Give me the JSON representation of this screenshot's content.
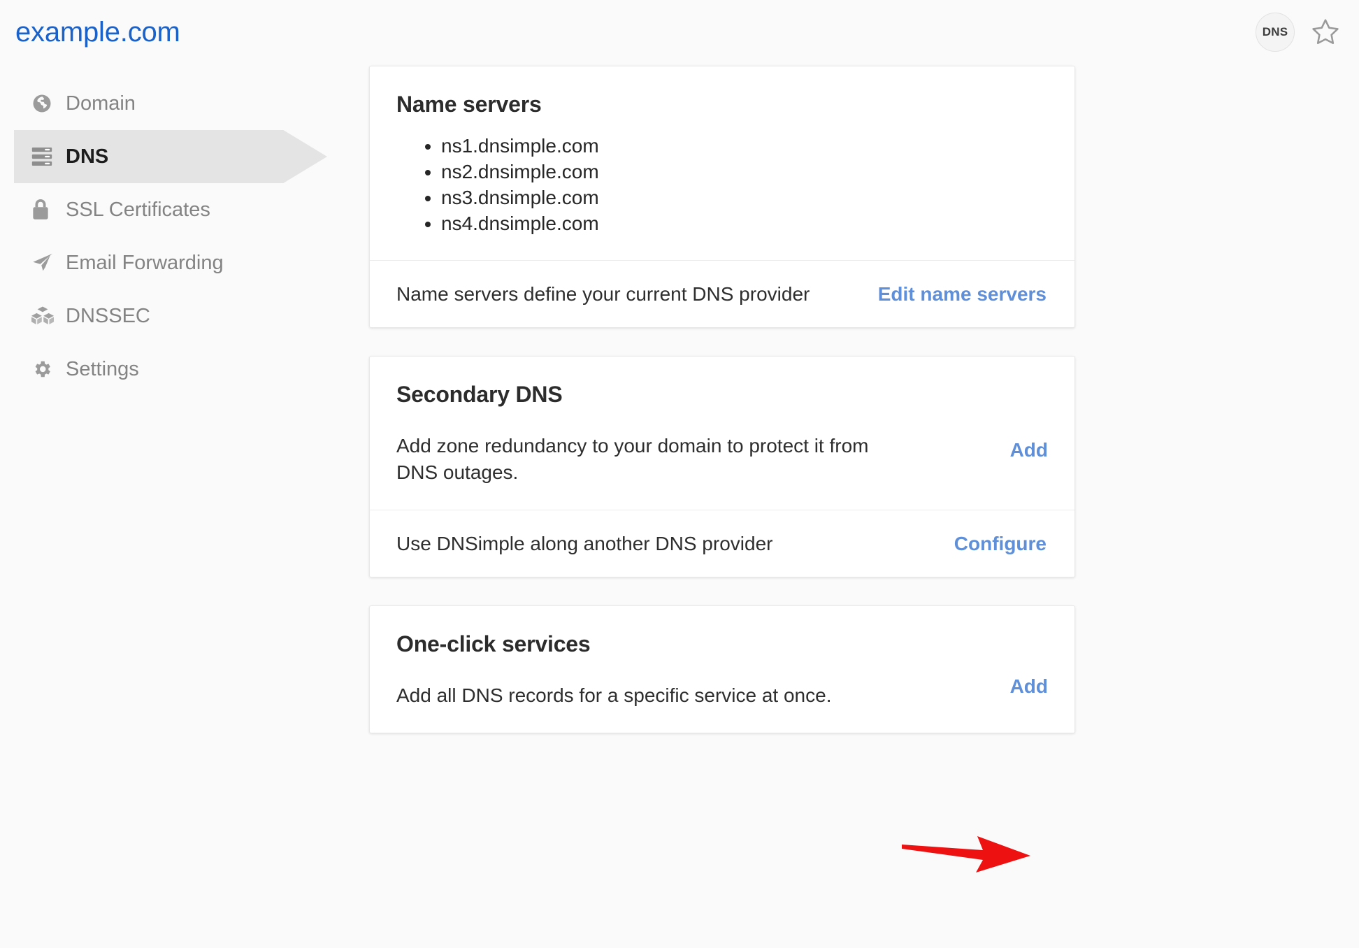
{
  "header": {
    "domain_title": "example.com",
    "badge_label": "DNS",
    "star_icon": "star-outline-icon",
    "title_color": "#1a62c9"
  },
  "sidebar": {
    "items": [
      {
        "label": "Domain",
        "icon": "globe-icon",
        "active": false
      },
      {
        "label": "DNS",
        "icon": "server-stack-icon",
        "active": true
      },
      {
        "label": "SSL Certificates",
        "icon": "lock-icon",
        "active": false
      },
      {
        "label": "Email Forwarding",
        "icon": "paper-plane-icon",
        "active": false
      },
      {
        "label": "DNSSEC",
        "icon": "cubes-icon",
        "active": false
      },
      {
        "label": "Settings",
        "icon": "gear-icon",
        "active": false
      }
    ],
    "active_background": "#e4e4e4"
  },
  "main": {
    "name_servers_card": {
      "title": "Name servers",
      "servers": [
        "ns1.dnsimple.com",
        "ns2.dnsimple.com",
        "ns3.dnsimple.com",
        "ns4.dnsimple.com"
      ],
      "footer_text": "Name servers define your current DNS provider",
      "footer_link": "Edit name servers"
    },
    "secondary_dns_card": {
      "title": "Secondary DNS",
      "description": "Add zone redundancy to your domain to protect it from DNS outages.",
      "description_link": "Add",
      "footer_text": "Use DNSimple along another DNS provider",
      "footer_link": "Configure"
    },
    "one_click_card": {
      "title": "One-click services",
      "description": "Add all DNS records for a specific service at once.",
      "description_link": "Add"
    }
  },
  "annotation": {
    "type": "red-arrow",
    "color": "#ee1111",
    "points_to": "Add",
    "direction": "right"
  }
}
